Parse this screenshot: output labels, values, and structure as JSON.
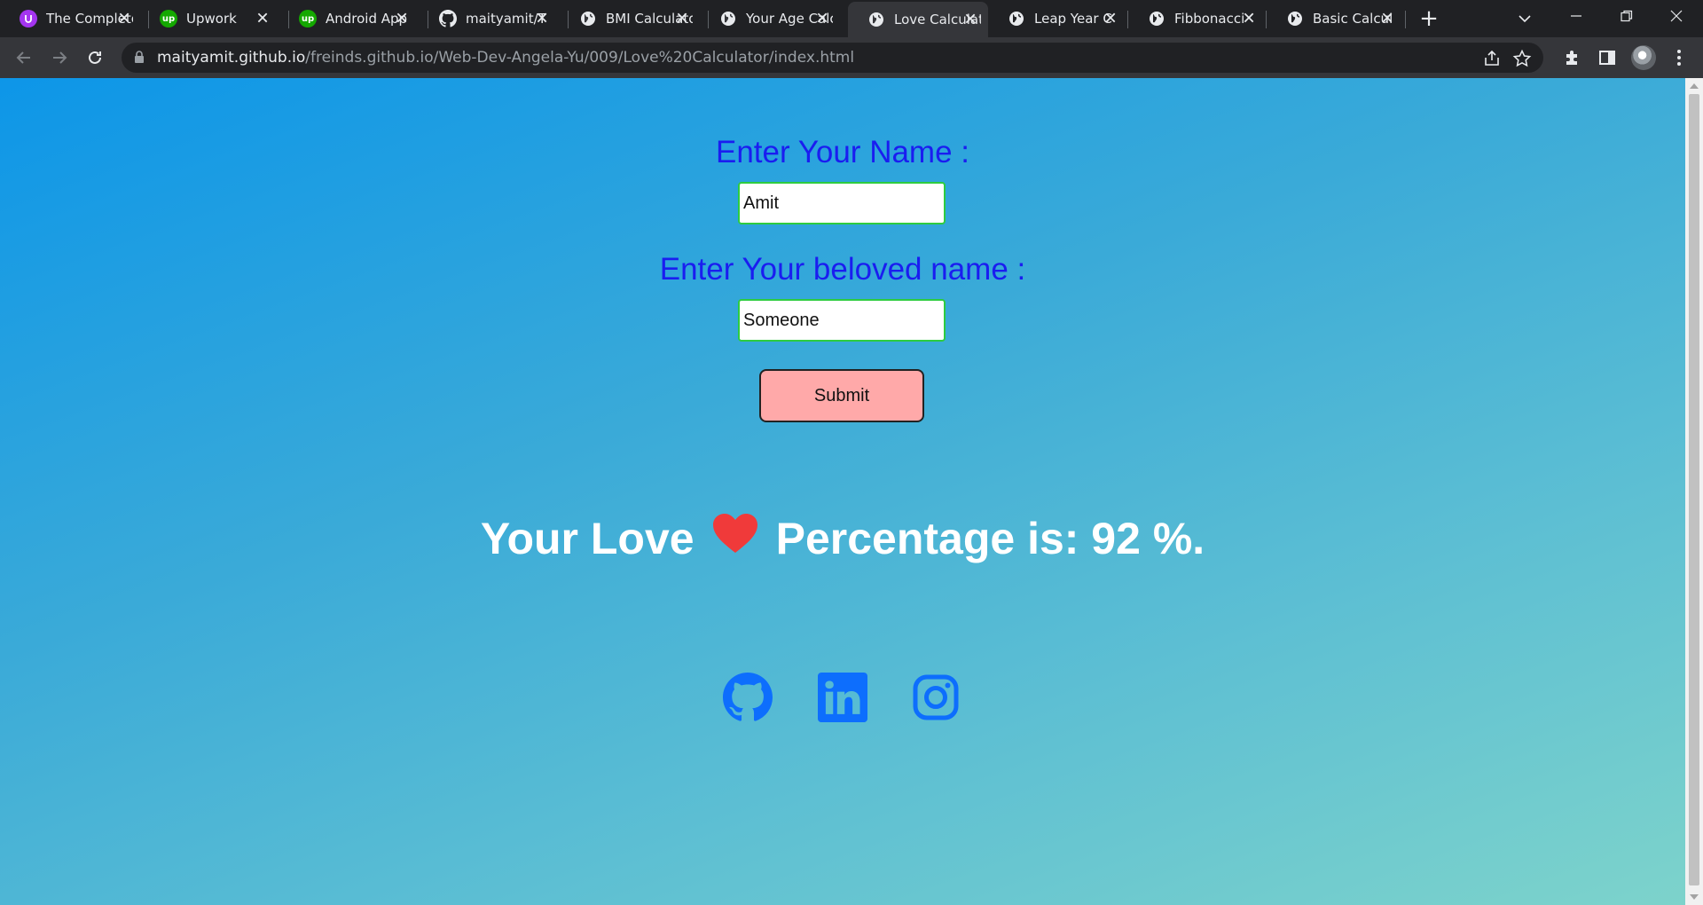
{
  "browser": {
    "tabs": [
      {
        "title": "The Complete",
        "favicon": "udemy-icon",
        "active": false
      },
      {
        "title": "Upwork",
        "favicon": "upwork-icon",
        "active": false
      },
      {
        "title": "Android App",
        "favicon": "upwork-icon",
        "active": false
      },
      {
        "title": "maityamit/T",
        "favicon": "github-icon",
        "active": false
      },
      {
        "title": "BMI Calculator",
        "favicon": "globe-icon",
        "active": false
      },
      {
        "title": "Your Age Calc",
        "favicon": "globe-icon",
        "active": false
      },
      {
        "title": "Love Calculator",
        "favicon": "globe-icon",
        "active": true
      },
      {
        "title": "Leap Year C",
        "favicon": "globe-icon",
        "active": false
      },
      {
        "title": "Fibbonacci",
        "favicon": "globe-icon",
        "active": false
      },
      {
        "title": "Basic Calcul",
        "favicon": "globe-icon",
        "active": false
      }
    ],
    "url_host": "maityamit.github.io",
    "url_path": "/freinds.github.io/Web-Dev-Angela-Yu/009/Love%20Calculator/index.html"
  },
  "form": {
    "name_label": "Enter Your Name :",
    "name_value": "Amit",
    "beloved_label": "Enter Your beloved name :",
    "beloved_value": "Someone",
    "submit_label": "Submit"
  },
  "result": {
    "prefix": "Your Love",
    "suffix": "Percentage is: 92 %."
  },
  "socials": [
    {
      "name": "github-icon"
    },
    {
      "name": "linkedin-icon"
    },
    {
      "name": "instagram-icon"
    }
  ],
  "colors": {
    "label": "#1a1df0",
    "heart": "#f03a3a",
    "social": "#0d6efd",
    "submit_bg": "#ffa9a9"
  }
}
